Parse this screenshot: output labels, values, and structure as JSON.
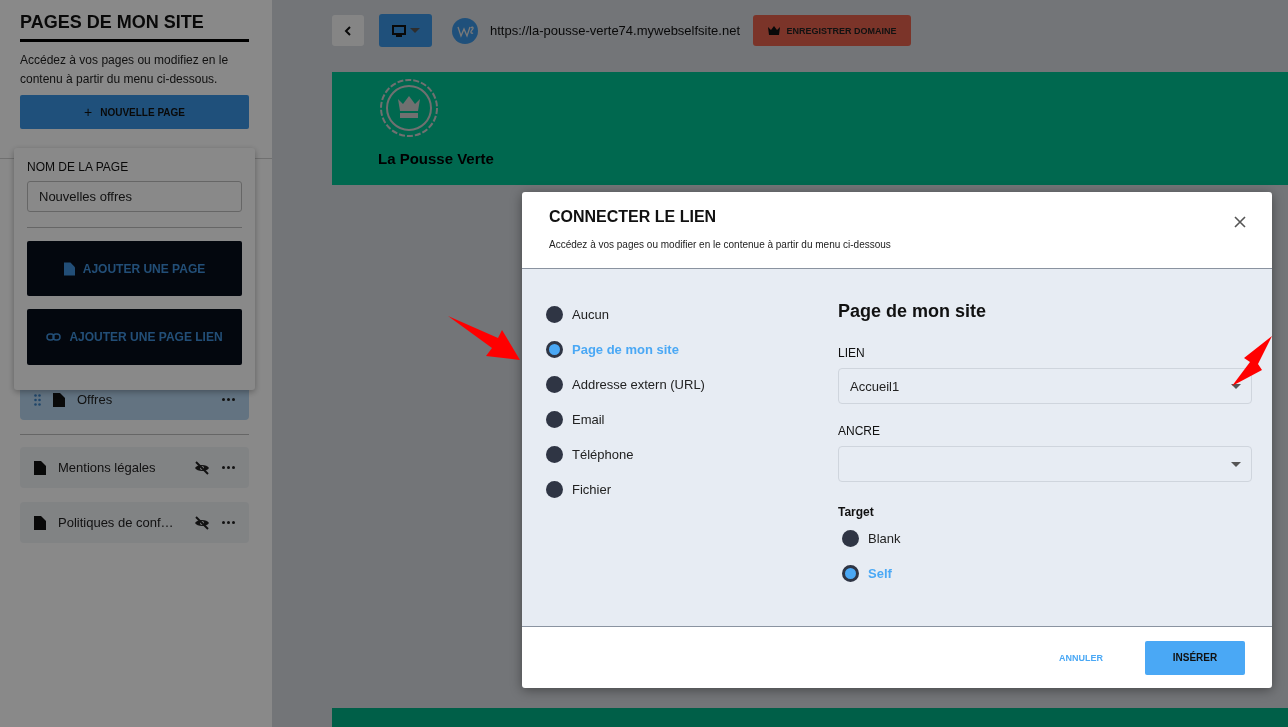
{
  "sidebar": {
    "title": "PAGES DE MON SITE",
    "description": "Accédez à vos pages ou modifiez en le contenu à partir du menu ci-dessous.",
    "new_page_button": {
      "icon": "+",
      "label": "NOUVELLE PAGE"
    },
    "pages": [
      {
        "label": "Offres",
        "selected": true,
        "hidden": false
      }
    ],
    "other_pages": [
      {
        "label": "Mentions légales",
        "hidden": true
      },
      {
        "label": "Politiques de conf…",
        "hidden": true
      }
    ],
    "page_form": {
      "label": "NOM DE LA PAGE",
      "value": "Nouvelles offres",
      "buttons": [
        {
          "kind": "page",
          "label": "AJOUTER UNE PAGE"
        },
        {
          "kind": "link",
          "label": "AJOUTER UNE PAGE LIEN"
        }
      ]
    }
  },
  "toolbar": {
    "url": "https://la-pousse-verte74.mywebselfsite.net",
    "domain_button": "ENREGISTRER DOMAINE"
  },
  "site": {
    "name": "La Pousse Verte"
  },
  "modal": {
    "title": "CONNECTER LE LIEN",
    "subtitle": "Accédez à vos pages ou modifier en le contenue à partir du menu ci-dessous",
    "link_types": [
      {
        "label": "Aucun",
        "selected": false
      },
      {
        "label": "Page de mon site",
        "selected": true
      },
      {
        "label": "Addresse extern (URL)",
        "selected": false
      },
      {
        "label": "Email",
        "selected": false
      },
      {
        "label": "Téléphone",
        "selected": false
      },
      {
        "label": "Fichier",
        "selected": false
      }
    ],
    "section_title": "Page de mon site",
    "fields": [
      {
        "label": "LIEN",
        "value": "Accueil1"
      },
      {
        "label": "ANCRE"
      }
    ],
    "target": {
      "label": "Target",
      "options": [
        {
          "label": "Blank",
          "selected": false
        },
        {
          "label": "Self",
          "selected": true
        }
      ]
    },
    "cancel_button": "ANNULER",
    "insert_button": "INSÉRER"
  }
}
